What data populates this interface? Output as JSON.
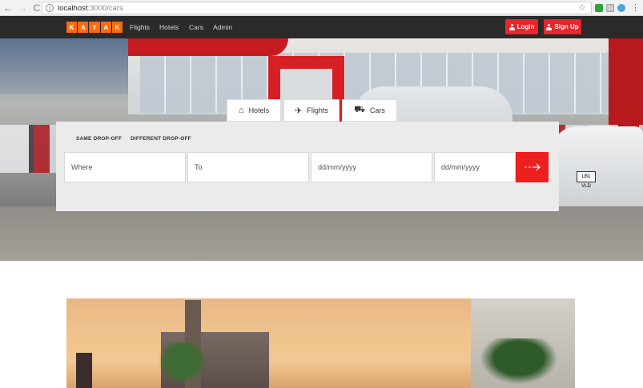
{
  "browser": {
    "url_host": "localhost",
    "url_path": ":3000/cars",
    "back_glyph": "←",
    "forward_glyph": "→",
    "reload_glyph": "C",
    "info_glyph": "i",
    "star_glyph": "☆",
    "menu_glyph": "⋮"
  },
  "navbar": {
    "logo_letters": [
      "K",
      "A",
      "Y",
      "A",
      "K"
    ],
    "links": [
      "Flights",
      "Hotels",
      "Cars",
      "Admin"
    ],
    "login_label": "Login",
    "signup_label": "Sign Up",
    "accent_color": "#e8262b",
    "logo_color": "#ff690f"
  },
  "search": {
    "tabs": [
      {
        "label": "Hotels",
        "icon": "hotel-icon"
      },
      {
        "label": "Flights",
        "icon": "plane-icon"
      },
      {
        "label": "Cars",
        "icon": "car-icon"
      }
    ],
    "modes": [
      "SAME DROP-OFF",
      "DIFFERENT DROP-OFF"
    ],
    "fields": [
      {
        "placeholder": "Where"
      },
      {
        "placeholder": "To"
      },
      {
        "placeholder": "dd/mm/yyyy"
      },
      {
        "placeholder": "dd/mm/yyyy"
      }
    ],
    "go_icon": "arrow-right-icon",
    "go_color": "#ee1f1f"
  },
  "hero": {
    "plate_text": "LB1 VLD"
  }
}
